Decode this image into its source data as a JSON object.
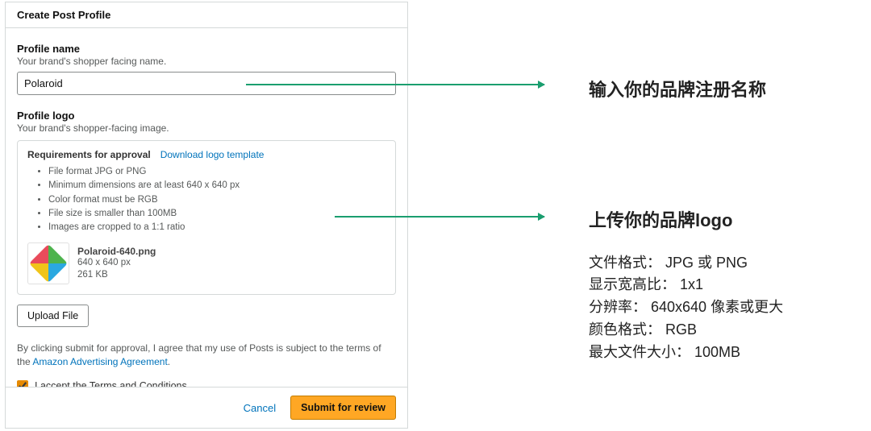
{
  "header": {
    "title": "Create Post Profile"
  },
  "profile_name": {
    "label": "Profile name",
    "sub": "Your brand's shopper facing name.",
    "value": "Polaroid"
  },
  "profile_logo": {
    "label": "Profile logo",
    "sub": "Your brand's shopper-facing image.",
    "req_title": "Requirements for approval",
    "download_link": "Download logo template",
    "reqs": [
      "File format JPG or PNG",
      "Minimum dimensions are at least 640 x 640 px",
      "Color format must be RGB",
      "File size is smaller than 100MB",
      "Images are cropped to a 1:1 ratio"
    ],
    "file": {
      "name": "Polaroid-640.png",
      "dims": "640 x 640 px",
      "size": "261 KB"
    },
    "upload_label": "Upload File"
  },
  "agreement": {
    "prefix": "By clicking submit for approval, I agree that my use of Posts is subject to the terms of the ",
    "link": "Amazon Advertising Agreement",
    "suffix": "."
  },
  "terms": {
    "label": "I accept the Terms and Conditions"
  },
  "footer": {
    "cancel": "Cancel",
    "submit": "Submit for review"
  },
  "annotations": {
    "a1_title": "输入你的品牌注册名称",
    "a2_title": "上传你的品牌logo",
    "a2_lines": [
      "文件格式： JPG 或 PNG",
      "显示宽高比： 1x1",
      "分辨率： 640x640 像素或更大",
      "颜色格式： RGB",
      "最大文件大小： 100MB"
    ]
  }
}
